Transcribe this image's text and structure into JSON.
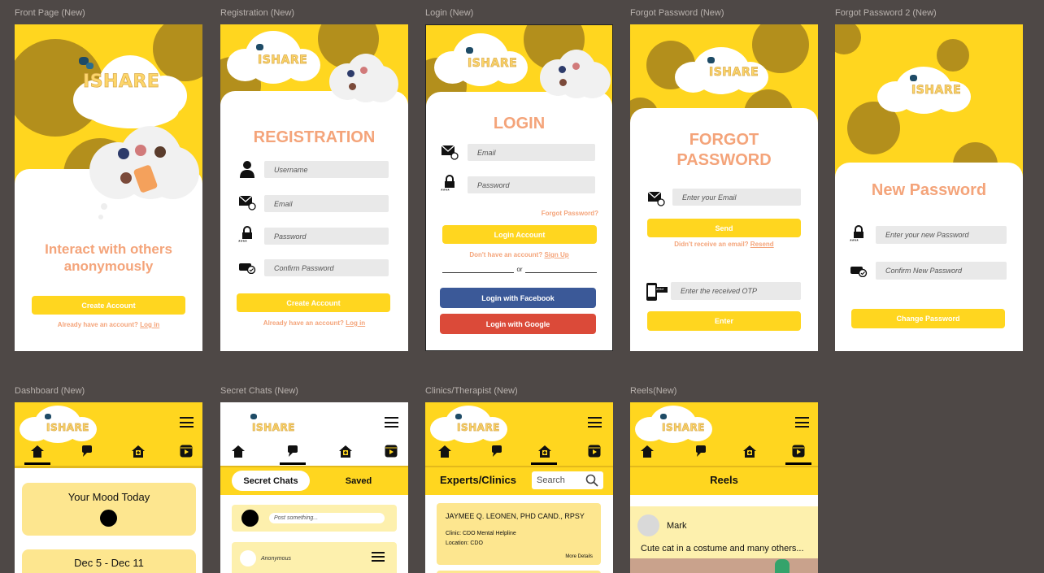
{
  "labels": {
    "front": "Front Page (New)",
    "registration": "Registration (New)",
    "login": "Login (New)",
    "forgot": "Forgot Password (New)",
    "forgot2": "Forgot Password 2 (New)",
    "dashboard": "Dashboard (New)",
    "secret": "Secret Chats (New)",
    "clinics": "Clinics/Therapist (New)",
    "reels": "Reels(New)"
  },
  "logo_text": "SHARE",
  "front": {
    "tagline_1": "Interact with others",
    "tagline_2": "anonymously",
    "create_button": "Create Account",
    "have_account": "Already have an account?",
    "login_link": "Log in"
  },
  "registration": {
    "title": "REGISTRATION",
    "username_placeholder": "Username",
    "email_placeholder": "Email",
    "password_placeholder": "Password",
    "confirm_placeholder": "Confirm Password",
    "create_button": "Create Account",
    "have_account": "Already have an account?",
    "login_link": "Log in"
  },
  "login": {
    "title": "LOGIN",
    "email_placeholder": "Email",
    "password_placeholder": "Password",
    "forgot_link": "Forgot Password?",
    "login_button": "Login Account",
    "no_account": "Don't  have an account?",
    "signup_link": "Sign Up",
    "or": "or",
    "facebook_button": "Login with Facebook",
    "google_button": "Login with Google"
  },
  "forgot": {
    "title_1": "FORGOT",
    "title_2": "PASSWORD",
    "email_placeholder": "Enter your Email",
    "send_button": "Send",
    "didnt_receive": "Didn't receive an email?",
    "resend_link": "Resend",
    "otp_placeholder": "Enter the received OTP",
    "enter_button": "Enter"
  },
  "forgot2": {
    "title": "New Password",
    "new_placeholder": "Enter your new Password",
    "confirm_placeholder": "Confirm New Password",
    "change_button": "Change Password"
  },
  "dashboard": {
    "mood_title": "Your Mood Today",
    "date_range": "Dec 5 - Dec 11"
  },
  "secret": {
    "tab_active": "Secret Chats",
    "tab_saved": "Saved",
    "post_placeholder": "Post something...",
    "anon_name": "Anonymous"
  },
  "clinics": {
    "title": "Experts/Clinics",
    "search_placeholder": "Search",
    "expert_name": "JAYMEE Q. LEONEN, PHD CAND., RPSY",
    "clinic": "Clinic: CDO Mental Helpline",
    "location": "Location: CDO",
    "more": "More Details"
  },
  "reels": {
    "title": "Reels",
    "user": "Mark",
    "caption": "Cute cat in a costume and many others..."
  },
  "colors": {
    "brand_yellow": "#ffd61f",
    "accent_peach": "#f4a47a",
    "blob_olive": "#b38f1c",
    "facebook": "#3b5998",
    "google": "#db4a39",
    "canvas": "#4e4846"
  }
}
